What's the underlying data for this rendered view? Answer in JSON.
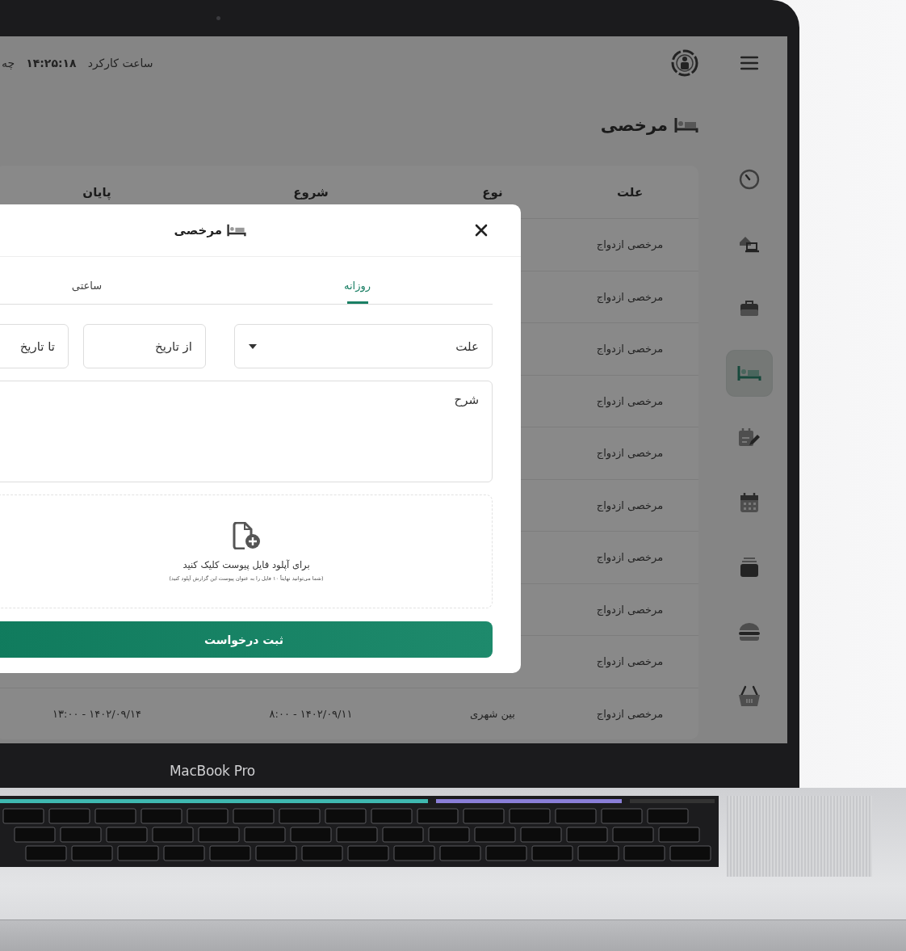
{
  "top_bar": {
    "work_time_label": "ساعت کارکرد",
    "work_time": "۱۴:۲۵:۱۸",
    "cut_text": "چه"
  },
  "sidebar": {
    "items": [
      {
        "selected": false
      },
      {
        "selected": false
      },
      {
        "selected": false
      },
      {
        "selected": true
      },
      {
        "selected": false
      },
      {
        "selected": false
      },
      {
        "selected": false
      },
      {
        "selected": false
      },
      {
        "selected": false
      }
    ]
  },
  "page_title": "مرخصی",
  "table": {
    "columns": [
      "علت",
      "نوع",
      "شروع",
      "پایان"
    ],
    "rows": [
      {
        "cells": [
          "مرخصی ازدواج"
        ]
      },
      {
        "cells": [
          "مرخصی ازدواج"
        ]
      },
      {
        "cells": [
          "مرخصی ازدواج"
        ]
      },
      {
        "cells": [
          "مرخصی ازدواج"
        ]
      },
      {
        "cells": [
          "مرخصی ازدواج"
        ]
      },
      {
        "cells": [
          "مرخصی ازدواج"
        ]
      },
      {
        "cells": [
          "مرخصی ازدواج"
        ]
      },
      {
        "cells": [
          "مرخصی ازدواج"
        ]
      },
      {
        "cells": [
          "مرخصی ازدواج"
        ]
      },
      {
        "cells": [
          "مرخصی ازدواج",
          "بین شهری",
          "۸:۰۰ - ۱۴۰۲/۰۹/۱۱",
          "۱۳:۰۰ - ۱۴۰۲/۰۹/۱۴"
        ]
      }
    ]
  },
  "modal": {
    "title": "مرخصی",
    "tabs": [
      {
        "label": "روزانه",
        "selected": true
      },
      {
        "label": "ساعتی",
        "selected": false
      }
    ],
    "fields": [
      {
        "kind": "select",
        "placeholder": "علت"
      },
      {
        "kind": "date",
        "placeholder": "از تاریخ"
      },
      {
        "kind": "date",
        "placeholder": "تا تاریخ"
      }
    ],
    "description": {
      "placeholder": "شرح"
    },
    "upload": {
      "label": "برای آپلود فایل پیوست کلیک کنید",
      "hint": "(شما می‌توانید نهایتاً ۱۰ فایل را به عنوان پیوست این گزارش آپلود کنید)"
    },
    "submit": "ثبت درخواست"
  },
  "device": {
    "label": "MacBook Pro"
  }
}
